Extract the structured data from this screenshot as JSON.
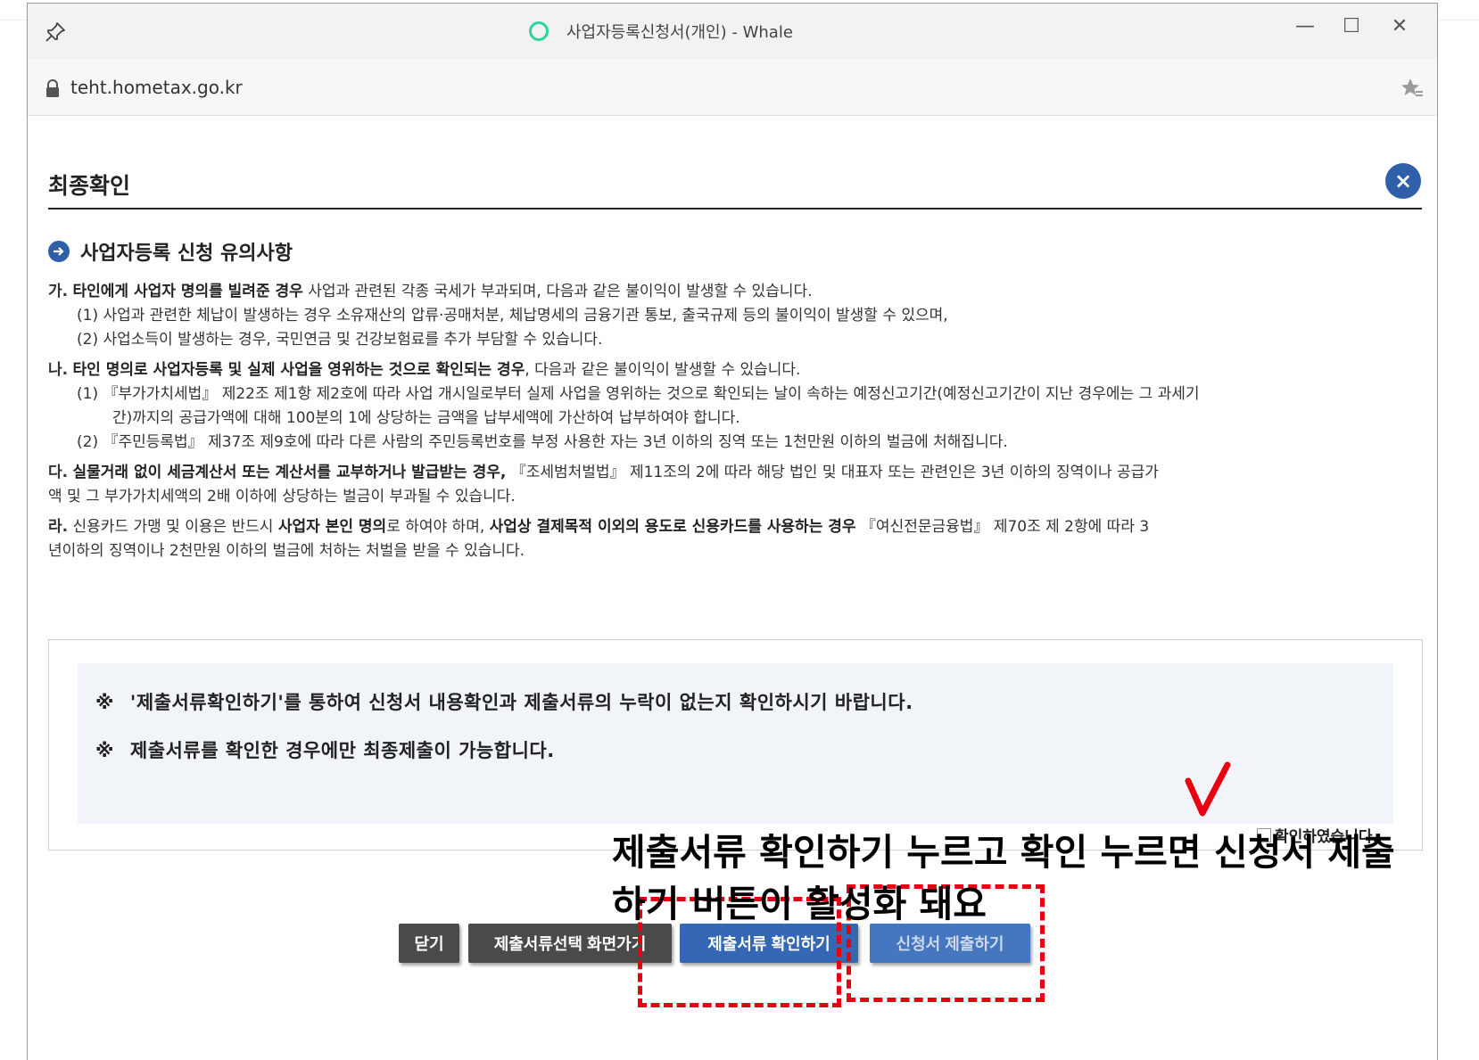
{
  "browser": {
    "window_title": "사업자등록신청서(개인) - Whale",
    "url": "teht.hometax.go.kr",
    "controls": {
      "minimize": "—",
      "maximize": "☐",
      "close": "✕"
    }
  },
  "dialog": {
    "title": "최종확인",
    "close_symbol": "×",
    "section_title": "사업자등록 신청 유의사항",
    "notes": {
      "ga": {
        "marker": "가.",
        "bold": "타인에게 사업자 명의를 빌려준 경우",
        "text": " 사업과 관련된 각종 국세가 부과되며, 다음과 같은 불이익이 발생할 수 있습니다.",
        "sub1": "(1) 사업과 관련한 체납이 발생하는 경우 소유재산의 압류·공매처분, 체납명세의 금융기관 통보, 출국규제 등의 불이익이 발생할 수 있으며,",
        "sub2": "(2) 사업소득이 발생하는 경우, 국민연금 및 건강보험료를 추가 부담할 수 있습니다."
      },
      "na": {
        "marker": "나.",
        "bold": "타인 명의로 사업자등록 및 실제 사업을 영위하는 것으로 확인되는 경우",
        "text": ", 다음과 같은 불이익이 발생할 수 있습니다.",
        "sub1a": "(1) 『부가가치세법』 제22조 제1항 제2호에 따라 사업 개시일로부터 실제 사업을 영위하는 것으로 확인되는 날이 속하는 예정신고기간(예정신고기간이 지난 경우에는 그 과세기",
        "sub1b": "간)까지의 공급가액에 대해 100분의 1에 상당하는 금액을 납부세액에 가산하여 납부하여야 합니다.",
        "sub2": "(2) 『주민등록법』 제37조 제9호에 따라 다른 사람의 주민등록번호를 부정 사용한 자는 3년 이하의 징역 또는 1천만원 이하의 벌금에 처해집니다."
      },
      "da": {
        "marker": "다.",
        "bold": "실물거래 없이 세금계산서 또는 계산서를 교부하거나 발급받는 경우,",
        "text": " 『조세범처벌법』 제11조의 2에 따라 해당 법인 및 대표자 또는 관련인은 3년 이하의 징역이나 공급가",
        "cont": "액 및 그 부가가치세액의 2배 이하에 상당하는 벌금이 부과될 수 있습니다."
      },
      "ra": {
        "marker": "라.",
        "t1": " 신용카드 가맹 및 이용은 반드시 ",
        "b1": "사업자 본인 명의",
        "t2": "로 하여야 하며, ",
        "b2": "사업상 결제목적 이외의 용도로 신용카드를 사용하는 경우",
        "t3": " 『여신전문금융법』 제70조 제 2항에 따라 3",
        "cont": "년이하의 징역이나 2천만원 이하의 벌금에 처하는 처벌을 받을 수 있습니다."
      }
    },
    "confirm": {
      "ref_mark": "※",
      "line1": "'제출서류확인하기'를 통하여 신청서 내용확인과 제출서류의 누락이 없는지 확인하시기 바랍니다.",
      "line2": "제출서류를 확인한 경우에만 최종제출이 가능합니다.",
      "checkbox_label": "확인하였습니다.",
      "checked": true
    },
    "buttons": {
      "close": "닫기",
      "go_select": "제출서류선택 화면가기",
      "check_docs": "제출서류 확인하기",
      "submit": "신청서 제출하기"
    }
  },
  "annotation": {
    "line1": "제출서류 확인하기 누르고 확인 누르면 신청서 제출",
    "line2": "하기 버튼이 활성화 돼요",
    "color": "#e60012"
  }
}
